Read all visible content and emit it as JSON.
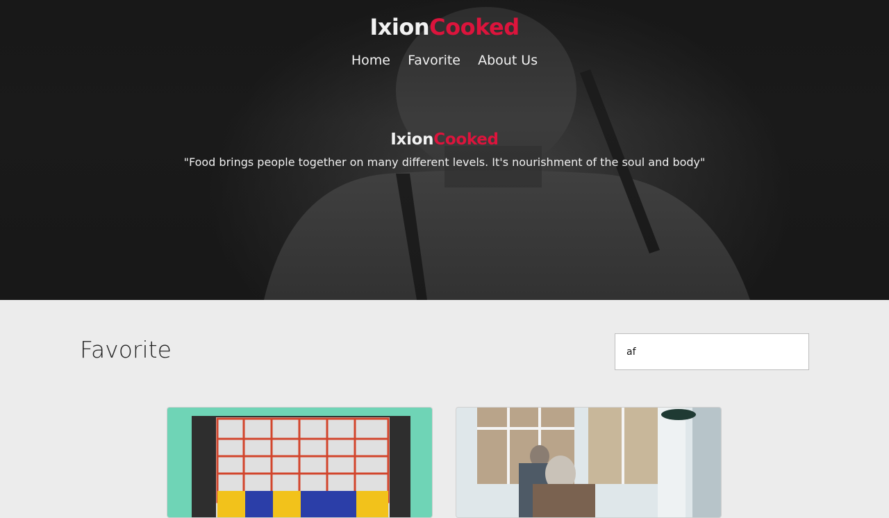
{
  "header": {
    "brand_part1": "Ixion",
    "brand_part2": "Cooked",
    "nav": [
      {
        "label": "Home"
      },
      {
        "label": "Favorite"
      },
      {
        "label": "About Us"
      }
    ]
  },
  "hero": {
    "title_part1": "Ixion",
    "title_part2": "Cooked",
    "quote": "\"Food brings people together on many different levels. It's nourishment of the soul and body\""
  },
  "main": {
    "section_title": "Favorite",
    "search": {
      "value": "af"
    }
  },
  "colors": {
    "accent": "#dc143c",
    "hero_dark": "#1c1c1c",
    "page_bg": "#ececec"
  }
}
